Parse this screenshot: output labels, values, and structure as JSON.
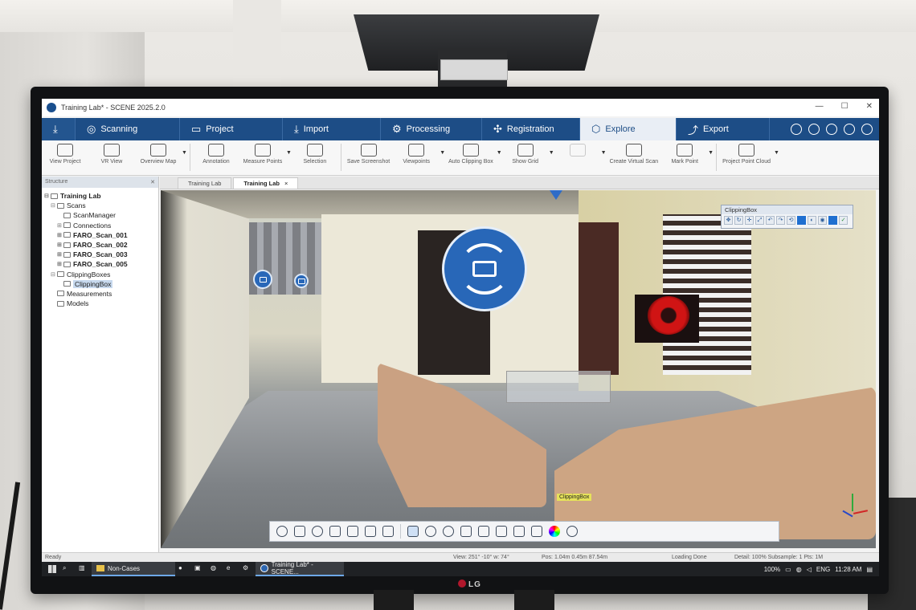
{
  "window": {
    "title": "Training Lab* - SCENE 2025.2.0",
    "controls": [
      "—",
      "☐",
      "✕"
    ]
  },
  "workflow_tabs": [
    {
      "label": "",
      "icon": "home-download-icon"
    },
    {
      "label": "Scanning",
      "icon": "scanner-icon"
    },
    {
      "label": "Project",
      "icon": "folder-icon"
    },
    {
      "label": "Import",
      "icon": "import-icon"
    },
    {
      "label": "Processing",
      "icon": "gear-icon"
    },
    {
      "label": "Registration",
      "icon": "puzzle-icon"
    },
    {
      "label": "Explore",
      "icon": "hexagon-icon",
      "active": true
    },
    {
      "label": "Export",
      "icon": "export-icon"
    }
  ],
  "ribbon": [
    {
      "label": "View Project"
    },
    {
      "label": "VR View"
    },
    {
      "label": "Overview Map",
      "caret": true
    },
    {
      "label": "Annotation"
    },
    {
      "label": "Measure Points",
      "caret": true
    },
    {
      "label": "Selection"
    },
    {
      "label": "Save Screenshot"
    },
    {
      "label": "Viewpoints",
      "caret": true
    },
    {
      "label": "Auto Clipping Box",
      "caret": true
    },
    {
      "label": "Show Grid",
      "caret": true
    },
    {
      "label": "",
      "disabled": true,
      "caret": true
    },
    {
      "label": "Create Virtual Scan"
    },
    {
      "label": "Mark Point",
      "caret": true
    },
    {
      "label": "Project Point Cloud",
      "caret": true
    }
  ],
  "structure_panel": {
    "header": "Structure",
    "tree": [
      {
        "label": "Training Lab",
        "level": 0,
        "bold": true,
        "exp": "⊟"
      },
      {
        "label": "Scans",
        "level": 1,
        "exp": "⊟"
      },
      {
        "label": "ScanManager",
        "level": 2,
        "exp": ""
      },
      {
        "label": "Connections",
        "level": 2,
        "exp": "⊞"
      },
      {
        "label": "FARO_Scan_001",
        "level": 2,
        "exp": "⊞",
        "bold": true
      },
      {
        "label": "FARO_Scan_002",
        "level": 2,
        "exp": "⊞",
        "bold": true
      },
      {
        "label": "FARO_Scan_003",
        "level": 2,
        "exp": "⊞",
        "bold": true
      },
      {
        "label": "FARO_Scan_005",
        "level": 2,
        "exp": "⊞",
        "bold": true
      },
      {
        "label": "ClippingBoxes",
        "level": 1,
        "exp": "⊟"
      },
      {
        "label": "ClippingBox",
        "level": 2,
        "exp": "",
        "selected": true
      },
      {
        "label": "Measurements",
        "level": 1,
        "exp": ""
      },
      {
        "label": "Models",
        "level": 1,
        "exp": ""
      }
    ]
  },
  "doc_tabs": [
    {
      "label": "Training Lab",
      "active": false
    },
    {
      "label": "Training Lab",
      "active": true,
      "close": "×"
    }
  ],
  "viewport": {
    "clipping_box_title": "ClippingBox",
    "scene_label": "ClippingBox"
  },
  "statusbar": {
    "ready": "Ready",
    "view": "View: 251° -10° w: 74°",
    "pos": "Pos: 1.04m 0.45m 87.54m",
    "loading": "Loading Done",
    "detail": "Detail: 100% Subsample: 1 Pts: 1M"
  },
  "taskbar": {
    "task1": "Non-Cases",
    "task2": "Training Lab* - SCENE...",
    "battery": "100%",
    "lang": "ENG",
    "time": "11:28 AM"
  },
  "monitor": {
    "brand": "LG"
  }
}
